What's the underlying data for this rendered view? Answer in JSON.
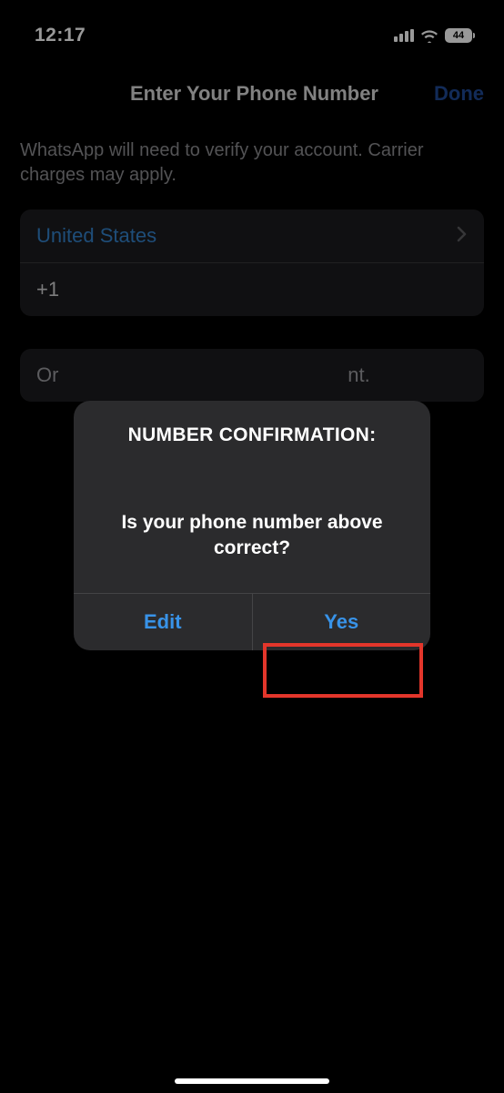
{
  "status_bar": {
    "time": "12:17",
    "battery_pct": "44"
  },
  "header": {
    "title": "Enter Your Phone Number",
    "done": "Done"
  },
  "info": "WhatsApp will need to verify your account. Carrier charges may apply.",
  "phone_entry": {
    "country": "United States",
    "code": "+1"
  },
  "alt_option": {
    "prefix": "Or",
    "suffix": "nt."
  },
  "alert": {
    "title": "NUMBER CONFIRMATION:",
    "message": "Is your phone number above correct?",
    "edit": "Edit",
    "yes": "Yes"
  }
}
